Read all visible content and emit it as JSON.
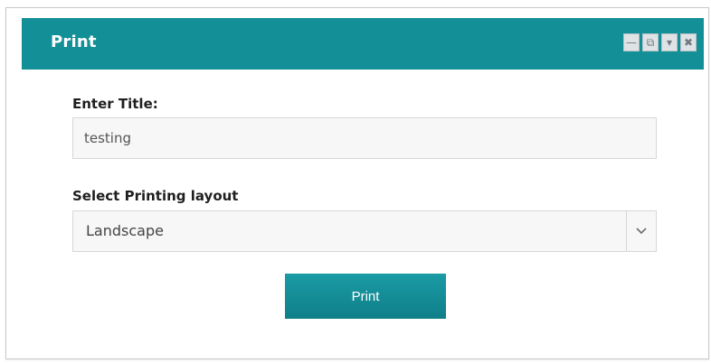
{
  "window": {
    "title": "Print",
    "controls": [
      {
        "name": "minimize-icon",
        "glyph": "—"
      },
      {
        "name": "popout-icon",
        "glyph": "⧉"
      },
      {
        "name": "dropdown-icon",
        "glyph": "▾"
      },
      {
        "name": "close-icon",
        "glyph": "✖"
      }
    ]
  },
  "form": {
    "title_label": "Enter Title:",
    "title_value": "testing",
    "layout_label": "Select Printing layout",
    "layout_value": "Landscape",
    "print_label": "Print"
  },
  "colors": {
    "accent": "#138f98"
  }
}
